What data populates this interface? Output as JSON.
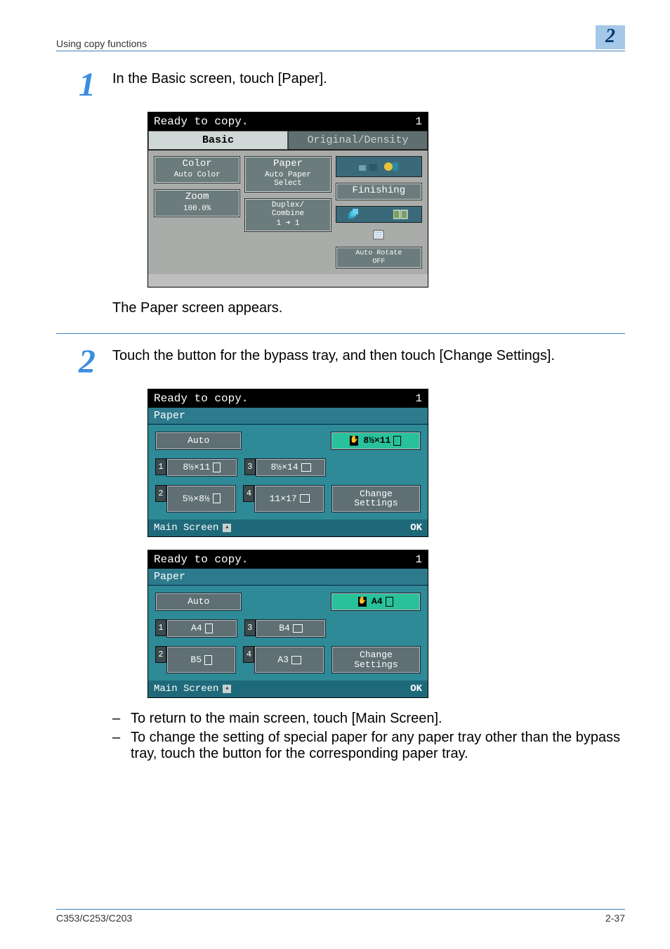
{
  "header": {
    "section": "Using copy functions",
    "chapter": "2"
  },
  "step1": {
    "num": "1",
    "text": "In the Basic screen, touch [Paper].",
    "after": "The Paper screen appears."
  },
  "step2": {
    "num": "2",
    "text": "Touch the button for the bypass tray, and then touch [Change Settings]."
  },
  "bullets": [
    "To return to the main screen, touch [Main Screen].",
    "To change the setting of special paper for any paper tray other than the bypass tray, touch the button for the corresponding paper tray."
  ],
  "screen_basic": {
    "status_left": "Ready to copy.",
    "status_right": "1",
    "tabs": {
      "basic": "Basic",
      "orig": "Original/Density"
    },
    "color": {
      "title": "Color",
      "sub": "Auto Color"
    },
    "paper": {
      "title": "Paper",
      "sub": "Auto Paper\nSelect"
    },
    "zoom": {
      "title": "Zoom",
      "sub": "100.0%"
    },
    "duplex": {
      "title": "Duplex/\nCombine",
      "sub": "1 ➜ 1"
    },
    "finishing": "Finishing",
    "autorotate": "Auto Rotate\nOFF"
  },
  "screen_paper_a": {
    "status_left": "Ready to copy.",
    "status_right": "1",
    "title": "Paper",
    "auto": "Auto",
    "bypass": "8½×11",
    "trays": [
      {
        "n": "1",
        "label": "8½×11",
        "orient": "port"
      },
      {
        "n": "3",
        "label": "8½×14",
        "orient": "land"
      },
      {
        "n": "2",
        "label": "5½×8½",
        "orient": "port"
      },
      {
        "n": "4",
        "label": "11×17",
        "orient": "land"
      }
    ],
    "change": "Change\nSettings",
    "main": "Main Screen",
    "ok": "OK"
  },
  "screen_paper_b": {
    "status_left": "Ready to copy.",
    "status_right": "1",
    "title": "Paper",
    "auto": "Auto",
    "bypass": "A4",
    "trays": [
      {
        "n": "1",
        "label": "A4",
        "orient": "port"
      },
      {
        "n": "3",
        "label": "B4",
        "orient": "land"
      },
      {
        "n": "2",
        "label": "B5",
        "orient": "port"
      },
      {
        "n": "4",
        "label": "A3",
        "orient": "land"
      }
    ],
    "change": "Change\nSettings",
    "main": "Main Screen",
    "ok": "OK"
  },
  "footer": {
    "model": "C353/C253/C203",
    "page": "2-37"
  }
}
